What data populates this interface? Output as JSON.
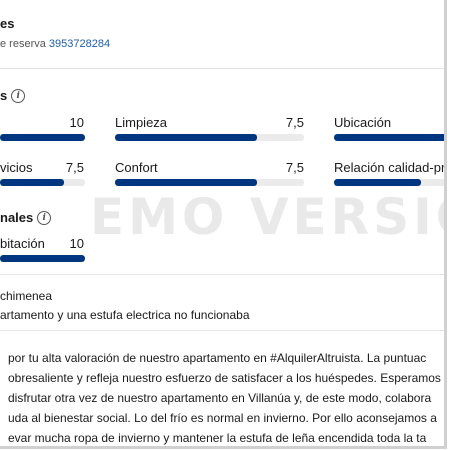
{
  "header": {
    "title": "es",
    "reservation_label": "e reserva",
    "reservation_number": "3953728284"
  },
  "scores": {
    "title": "s",
    "items": [
      {
        "label": "",
        "score": "10",
        "value": 10
      },
      {
        "label": "Limpieza",
        "score": "7,5",
        "value": 7.5
      },
      {
        "label": "Ubicación",
        "score": "",
        "value": 10
      },
      {
        "label": "vicios",
        "score": "7,5",
        "value": 7.5
      },
      {
        "label": "Confort",
        "score": "7,5",
        "value": 7.5
      },
      {
        "label": "Relación calidad-pre",
        "score": "",
        "value": 7.5
      }
    ]
  },
  "extra_scores": {
    "title": "nales",
    "items": [
      {
        "label": "bitación",
        "score": "10",
        "value": 10
      }
    ]
  },
  "watermark": "EMO VERSIO",
  "review": {
    "positive": "chimenea",
    "negative": "artamento y una estufa electrica no funcionaba"
  },
  "reply": {
    "lines": [
      "por tu alta valoración de nuestro apartamento en #AlquilerAltruista. La puntuac",
      "obresaliente y refleja nuestro esfuerzo de satisfacer a los huéspedes. Esperamos",
      "disfrutar otra vez de nuestro apartamento en Villanúa y, de este modo, colabora",
      "uda al bienestar social. Lo del frío es normal en invierno. Por ello aconsejamos a",
      "evar mucha ropa de invierno y mantener la estufa de leña encendida toda la ta"
    ]
  }
}
